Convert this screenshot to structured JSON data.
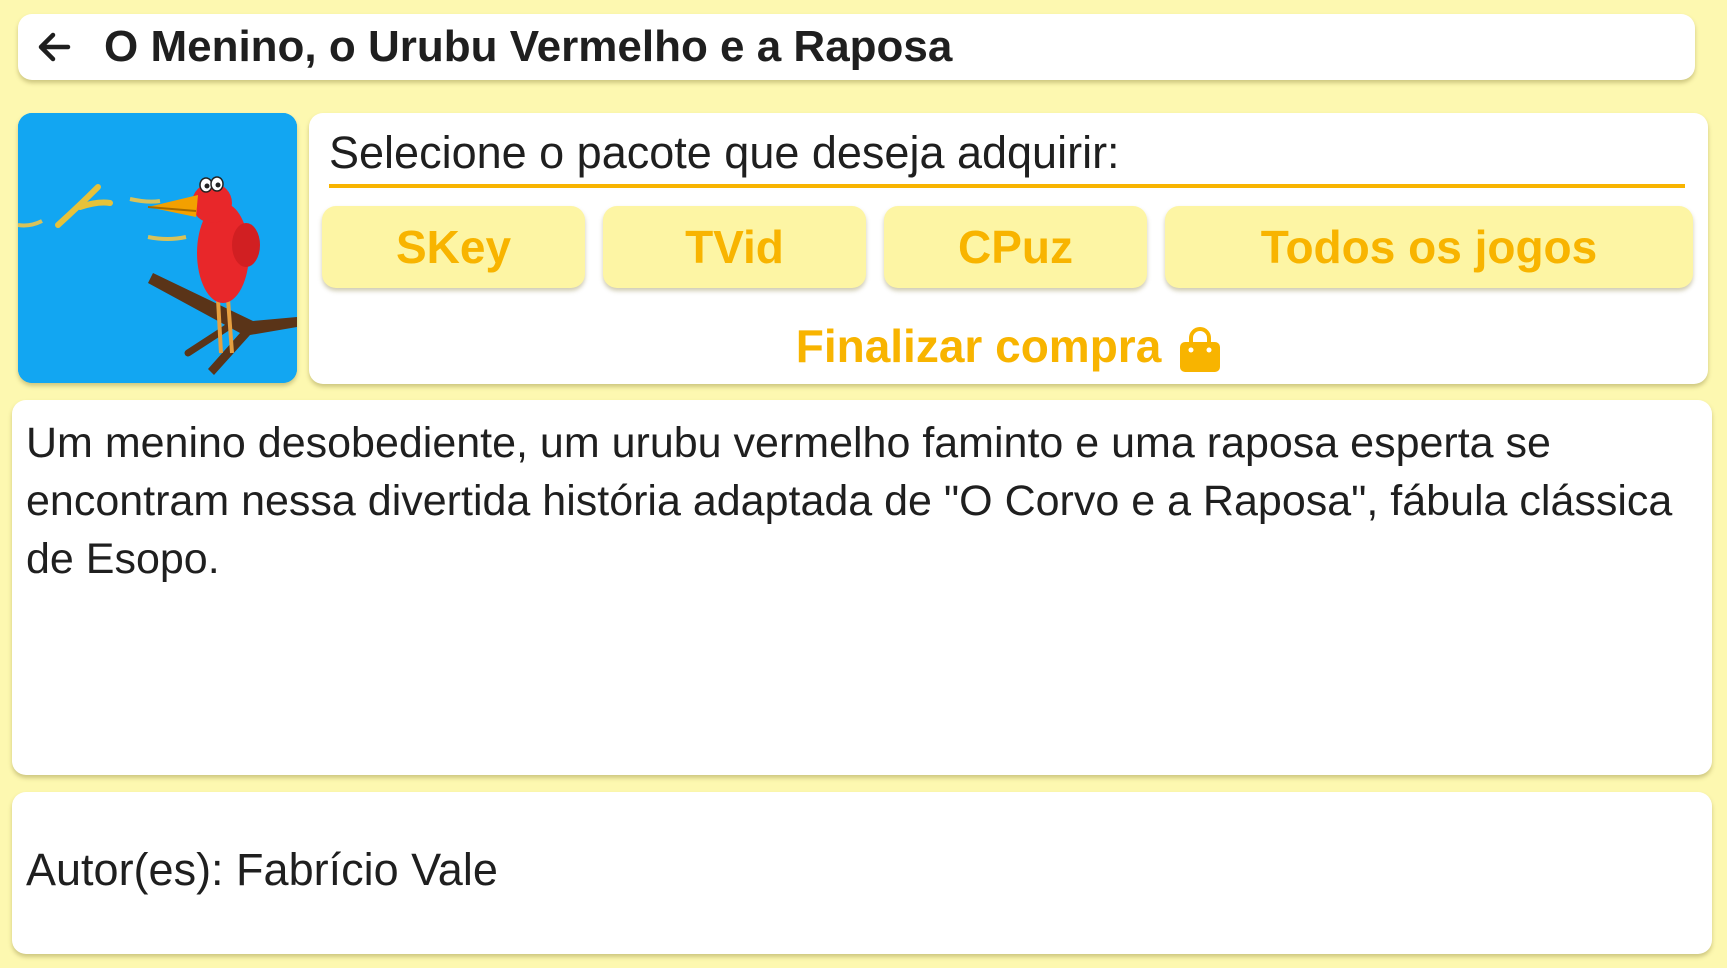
{
  "header": {
    "back_icon": "arrow-left-icon",
    "title": "O Menino, o Urubu Vermelho e a Raposa"
  },
  "thumbnail": {
    "image": "red-bird-on-branch-illustration",
    "background_color": "#12a6f2"
  },
  "package": {
    "prompt": "Selecione o pacote que deseja adquirir:",
    "buttons": [
      "SKey",
      "TVid",
      "CPuz",
      "Todos os jogos"
    ],
    "checkout_label": "Finalizar compra",
    "checkout_icon": "shopping-bag-icon"
  },
  "description": {
    "text": "Um menino desobediente, um urubu vermelho faminto e uma raposa esperta se encontram nessa divertida história adaptada de \"O Corvo e a Raposa\", fábula clássica de Esopo."
  },
  "author": {
    "text": "Autor(es): Fabrício Vale"
  },
  "colors": {
    "page_background": "#fdf8b0",
    "accent": "#f8b400",
    "button_background": "#fdf5a4",
    "text": "#1f1f1f"
  }
}
